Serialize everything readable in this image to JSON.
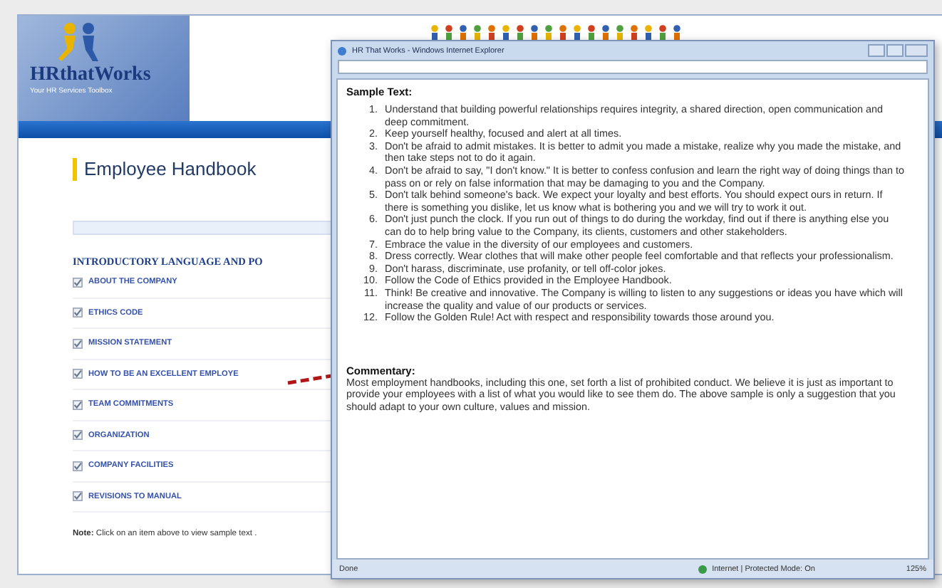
{
  "site": {
    "logo": "HRthatWorks",
    "tagline": "Your HR Services Toolbox",
    "page_title": "Employee Handbook"
  },
  "section": {
    "heading": "INTRODUCTORY LANGUAGE AND PO",
    "items": [
      {
        "label": "ABOUT THE COMPANY"
      },
      {
        "label": "ETHICS CODE"
      },
      {
        "label": "MISSION STATEMENT"
      },
      {
        "label": "HOW TO BE AN EXCELLENT EMPLOYE"
      },
      {
        "label": "TEAM COMMITMENTS"
      },
      {
        "label": "ORGANIZATION"
      },
      {
        "label": "COMPANY FACILITIES"
      },
      {
        "label": "REVISIONS TO MANUAL"
      }
    ],
    "note_label": "Note:",
    "note": "Click on an item above to view sample text ."
  },
  "popup": {
    "title": "HR That Works - Windows Internet Explorer",
    "heading": "Sample Text:",
    "items": [
      {
        "number": "1.",
        "text": "Understand that building powerful relationships requires integrity, a shared direction, open communication and deep commitment."
      },
      {
        "number": "2.",
        "text": "Keep yourself healthy, focused and alert at all times."
      },
      {
        "number": "3.",
        "text": "Don't be afraid to admit mistakes. It is better to admit you made a mistake, realize why you made the mistake, and then take steps not to do it again."
      },
      {
        "number": "4.",
        "text": "Don't be afraid to say, \"I don't know.\" It is better to confess confusion and learn the right way of doing things than to pass on or rely on false information that may be damaging to you and the Company."
      },
      {
        "number": "5.",
        "text": "Don't talk behind someone's back. We expect your loyalty and best efforts. You should expect ours in return. If there is something you dislike, let us know what is bothering you and we will try to work it out."
      },
      {
        "number": "6.",
        "text": "Don't just punch the clock. If you run out of things to do during the workday, find out if there is anything else you can do to help bring value to the Company, its clients, customers and other stakeholders."
      },
      {
        "number": "7.",
        "text": "Embrace the value in the diversity of our employees and customers."
      },
      {
        "number": "8.",
        "text": "Dress correctly. Wear clothes that will make other people feel comfortable and that reflects your professionalism."
      },
      {
        "number": "9.",
        "text": "Don't harass, discriminate, use profanity, or tell off-color jokes."
      },
      {
        "number": "10.",
        "text": "Follow the Code of Ethics provided in the Employee Handbook."
      },
      {
        "number": "11.",
        "text": "Think! Be creative and innovative. The Company is willing to listen to any suggestions or ideas you have which will increase the quality and value of our products or services."
      },
      {
        "number": "12.",
        "text": "Follow the Golden Rule! Act with respect and responsibility towards those around you."
      }
    ],
    "commentary_heading": "Commentary:",
    "commentary": "Most employment handbooks, including this one, set forth a list of prohibited conduct. We believe it is just as important to provide your employees with a list of what you would like to see them do. The above sample is only a suggestion that you should adapt to your own culture, values and mission.",
    "status": "Done",
    "zone": "Internet | Protected Mode: On",
    "zoom": "125%"
  }
}
